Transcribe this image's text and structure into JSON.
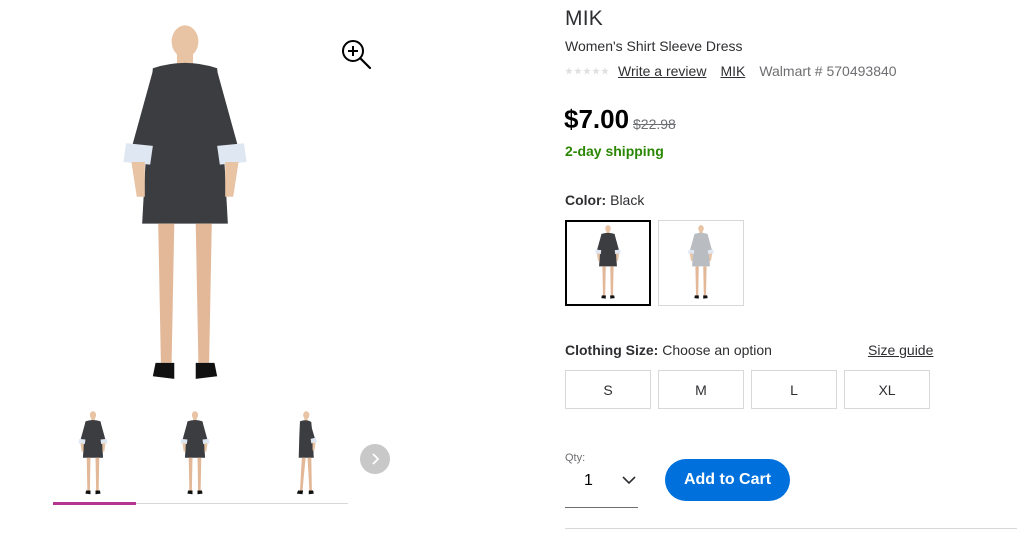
{
  "product": {
    "brand": "MIK",
    "title": "Women's Shirt Sleeve Dress",
    "rating_stars": 0,
    "write_review_label": "Write a review",
    "brand_link": "MIK",
    "sku_text": "Walmart # 570493840",
    "price": "$7.00",
    "was_price": "$22.98",
    "shipping": "2-day shipping"
  },
  "color": {
    "label": "Color:",
    "selected_value": "Black",
    "swatches": [
      {
        "name": "Black",
        "selected": true,
        "color": "#3c3d40"
      },
      {
        "name": "Gray",
        "selected": false,
        "color": "#b9bcc0"
      }
    ]
  },
  "size": {
    "label": "Clothing Size:",
    "prompt": "Choose an option",
    "guide_label": "Size guide",
    "options": [
      "S",
      "M",
      "L",
      "XL"
    ]
  },
  "quantity": {
    "label": "Qty:",
    "value": "1"
  },
  "cart": {
    "add_label": "Add to Cart"
  },
  "gallery": {
    "thumbnails": 3,
    "active_index": 0
  },
  "colors": {
    "accent_blue": "#0071dc",
    "shipping_green": "#2a8703",
    "active_thumb_bar": "#b6358f"
  },
  "icons": [
    "zoom-in-icon",
    "chevron-right-icon",
    "chevron-down-icon",
    "star-icon"
  ]
}
